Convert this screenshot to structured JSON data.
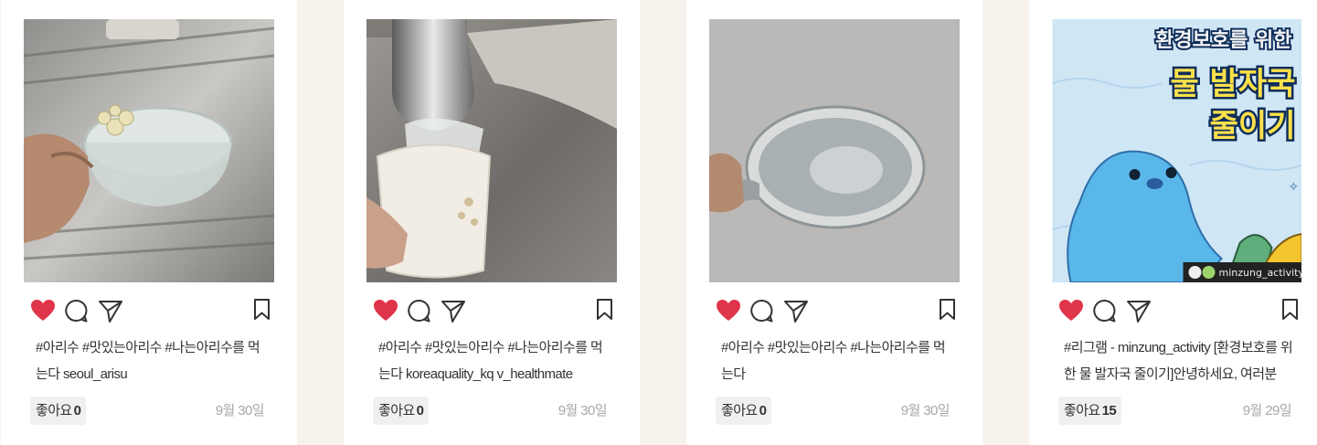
{
  "posts": [
    {
      "caption": "#아리수 #맛있는아리수 #나는아리수를 먹는다 seoul_arisu",
      "likes_label": "좋아요",
      "likes_count": "0",
      "date": "9월 30일"
    },
    {
      "caption": "#아리수 #맛있는아리수 #나는아리수를 먹는다 koreaquality_kq v_healthmate",
      "likes_label": "좋아요",
      "likes_count": "0",
      "date": "9월 30일"
    },
    {
      "caption": "#아리수 #맛있는아리수 #나는아리수를 먹는다",
      "likes_label": "좋아요",
      "likes_count": "0",
      "date": "9월 30일"
    },
    {
      "caption": "#리그램 - minzung_activity [환경보호를 위한 물 발자국 줄이기]안녕하세요, 여러분",
      "likes_label": "좋아요",
      "likes_count": "15",
      "date": "9월 29일",
      "image_text": {
        "line1": "환경보호를 위한",
        "line2": "물 발자국",
        "line3": "줄이기",
        "handle": "minzung_activity"
      }
    }
  ],
  "icons": {
    "like": "heart-icon",
    "comment": "comment-icon",
    "share": "paper-plane-icon",
    "save": "bookmark-icon"
  },
  "colors": {
    "heart": "#e0344a",
    "background": "#f7f3ec",
    "card": "#ffffff",
    "date": "#a7a7a7"
  }
}
